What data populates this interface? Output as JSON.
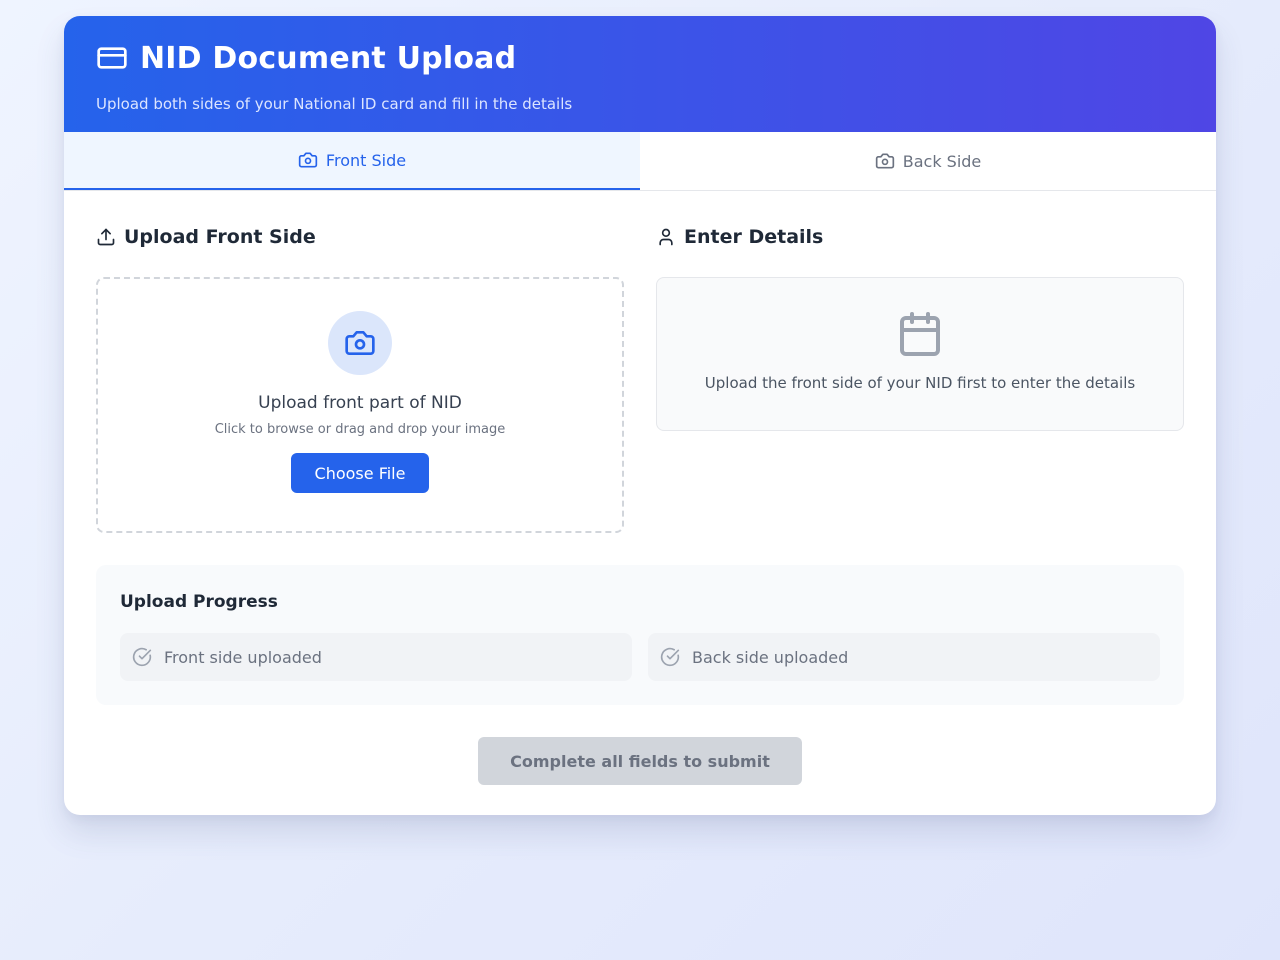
{
  "header": {
    "title": "NID Document Upload",
    "subtitle": "Upload both sides of your National ID card and fill in the details",
    "icon": "credit-card-icon"
  },
  "tabs": [
    {
      "label": "Front Side",
      "icon": "camera-icon",
      "active": true
    },
    {
      "label": "Back Side",
      "icon": "camera-icon",
      "active": false
    }
  ],
  "upload": {
    "title": "Upload Front Side",
    "icon": "upload-icon",
    "dropzone": {
      "main": "Upload front part of NID",
      "sub": "Click to browse or drag and drop your image",
      "button": "Choose File"
    }
  },
  "details": {
    "title": "Enter Details",
    "icon": "user-icon",
    "placeholder_text": "Upload the front side of your NID first to enter the details",
    "placeholder_icon": "calendar-icon"
  },
  "progress": {
    "title": "Upload Progress",
    "items": [
      {
        "label": "Front side uploaded",
        "done": false
      },
      {
        "label": "Back side uploaded",
        "done": false
      }
    ]
  },
  "submit": {
    "label": "Complete all fields to submit",
    "disabled": true
  },
  "colors": {
    "primary": "#2563eb",
    "header_gradient_end": "#4f46e5",
    "disabled_bg": "#d1d5db"
  }
}
